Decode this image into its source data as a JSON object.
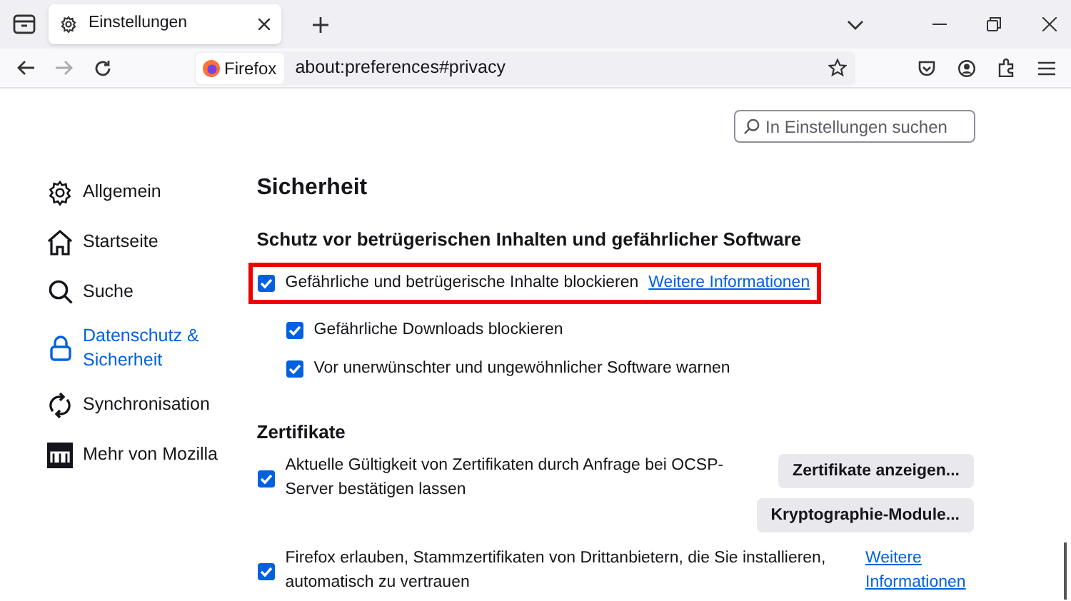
{
  "tabs": [
    {
      "label": "Einstellungen",
      "selected": true
    }
  ],
  "toolbar": {
    "identity": "Firefox",
    "url": "about:preferences#privacy"
  },
  "search": {
    "placeholder": "In Einstellungen suchen"
  },
  "sidebar": {
    "items": [
      {
        "label": "Allgemein",
        "selected": false
      },
      {
        "label": "Startseite",
        "selected": false
      },
      {
        "label": "Suche",
        "selected": false
      },
      {
        "label": "Datenschutz & Sicherheit",
        "selected": true
      },
      {
        "label": "Synchronisation",
        "selected": false
      },
      {
        "label": "Mehr von Mozilla",
        "selected": false
      }
    ]
  },
  "page_title": "Sicherheit",
  "sections": [
    {
      "heading": "Schutz vor betrügerischen Inhalten und gefährlicher Software",
      "options": [
        {
          "label": "Gefährliche und betrügerische Inhalte blockieren",
          "checked": true,
          "highlighted": true,
          "nested": false,
          "link": "Weitere Informationen"
        },
        {
          "label": "Gefährliche Downloads blockieren",
          "checked": true,
          "highlighted": false,
          "nested": true
        },
        {
          "label": "Vor unerwünschter und ungewöhnlicher Software warnen",
          "checked": true,
          "highlighted": false,
          "nested": true
        }
      ]
    },
    {
      "heading": "Zertifikate",
      "options": [
        {
          "label": "Aktuelle Gültigkeit von Zertifikaten durch Anfrage bei OCSP-Server bestätigen lassen",
          "checked": true,
          "highlighted": false,
          "nested": false,
          "buttons": [
            "Zertifikate anzeigen...",
            "Kryptographie-Module..."
          ]
        },
        {
          "label": "Firefox erlauben, Stammzertifikaten von Drittanbietern, die Sie installieren, automatisch zu vertrauen",
          "checked": true,
          "highlighted": false,
          "nested": false,
          "link": "Weitere Informationen"
        }
      ]
    }
  ]
}
